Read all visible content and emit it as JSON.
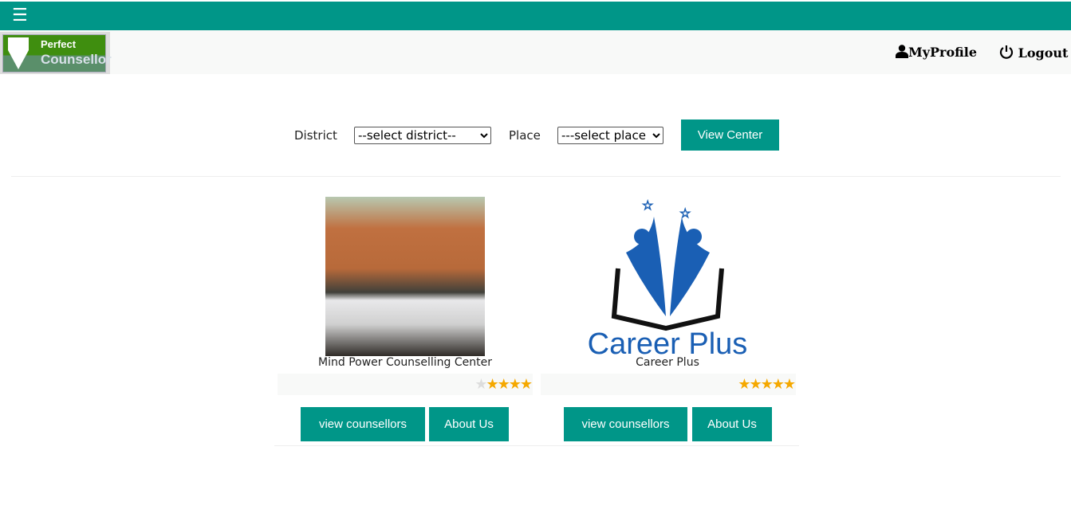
{
  "header": {
    "menu_icon": "☰",
    "logo_line1": "Perfect",
    "logo_line2": "Counsellor",
    "profile": "MyProfile",
    "logout": "Logout"
  },
  "filters": {
    "district_label": "District",
    "district_value": "--select district--",
    "place_label": "Place",
    "place_value": "---select place",
    "view_button": "View Center"
  },
  "centers": [
    {
      "name": "Mind Power Counselling Center",
      "rating": 4,
      "max_rating": 5,
      "view_label": "view counsellors",
      "about_label": "About Us"
    },
    {
      "name": "Career Plus",
      "rating": 5,
      "max_rating": 5,
      "view_label": "view counsellors",
      "about_label": "About Us",
      "logo_text": "Career Plus"
    }
  ],
  "colors": {
    "accent": "#009688",
    "star": "#f5a800"
  }
}
